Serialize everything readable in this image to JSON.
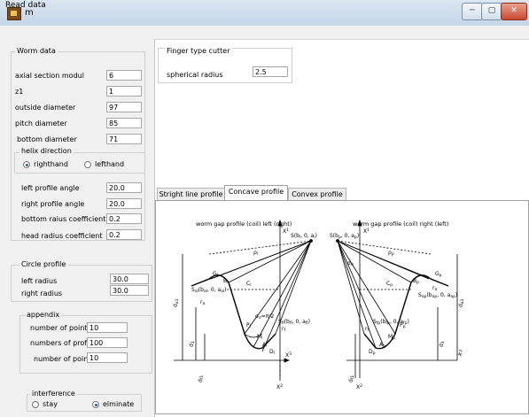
{
  "window": {
    "title": "m",
    "min_glyph": "─",
    "max_glyph": "▢",
    "close_glyph": "✕"
  },
  "menu": {
    "read_data": "Read data"
  },
  "worm": {
    "group_label": "Worm data",
    "fields": [
      {
        "label": "axial  section modul",
        "value": "6"
      },
      {
        "label": "z1",
        "value": "1"
      },
      {
        "label": "outside diameter",
        "value": "97"
      },
      {
        "label": "pitch diameter",
        "value": "85"
      },
      {
        "label": "bottom diameter",
        "value": "71"
      }
    ],
    "helix": {
      "label": "helix direction",
      "right": "righthand",
      "left": "lefthand",
      "selected": "righthand"
    },
    "profile_fields": [
      {
        "label": "left profile angle",
        "value": "20.0"
      },
      {
        "label": "right profile angle",
        "value": "20.0"
      },
      {
        "label": "bottom raius coefficient",
        "value": "0.2"
      },
      {
        "label": "head radius coefficient",
        "value": "0.2"
      }
    ]
  },
  "circle": {
    "group_label": "Circle profile",
    "left_label": "left radius",
    "left_value": "30.0",
    "right_label": "right radius",
    "right_value": "30.0"
  },
  "appendix": {
    "group_label": "appendix",
    "fields": [
      {
        "label": "number of points - botto",
        "value": "10"
      },
      {
        "label": "numbers of profile point",
        "value": "100"
      },
      {
        "label": "number of points - hea",
        "value": "10"
      }
    ]
  },
  "interference": {
    "group_label": "interference",
    "stay": "stay",
    "eliminate": "elminate",
    "selected": "eliminate"
  },
  "finger": {
    "group_label": "Finger type cutter",
    "radius_label": "spherical radius",
    "radius_value": "2.5"
  },
  "tabs": {
    "straight": "Stright line profile",
    "concave": "Concave profile",
    "convex": "Convex profile",
    "active": "concave"
  },
  "diagram": {
    "left_title": "worm gap profile (coil) left (right)",
    "right_title": "worm gap profile (coil) right (left)",
    "left_labels": {
      "x1": "X",
      "x1_sup": "1",
      "s_top": "S(b",
      "s_top_rest": ", 0, a",
      "r": "r",
      "c": "C",
      "g": "G",
      "b": "B",
      "sa": "S",
      "sa_rest": "(b",
      "sa_rest2": ", 0, a",
      "p": "P",
      "m": "M",
      "a": "A",
      "d": "D",
      "sf": "S",
      "sf_rest": "(b",
      "sf_rest2": ", 0, a",
      "da": "d",
      "da_sub": "a1",
      "d1": "d",
      "d1_sub": "1",
      "df": "d",
      "df_sub": "f1",
      "x3": "X",
      "x3_sup": "3",
      "x2": "X",
      "x2_sup": "2",
      "sigma": "σ",
      "rho": "ρ",
      "ra": "r",
      "s_sub": "l",
      "s_sub2": "l",
      "sa_sub": "al",
      "sa_sub2": "al",
      "sa_sub3": "al",
      "sf_sub": "fl",
      "sf_sub2": "fl",
      "sf_sub3": "fl",
      "sigma_sub": "σ",
      "pi": "π/2",
      "ra_sub": "a",
      "rf": "f",
      "g_sub": "l",
      "b_sub": "l",
      "p_sub": "l",
      "m_sub": "l",
      "a_sub": "l",
      "d_sub": "l",
      "c_sub": "l",
      "r_sub": "l"
    },
    "right_labels": {
      "x1": "X",
      "x1_sup": "1",
      "s_top": "S(b",
      "s_top_rest": ", 0, a",
      "r": "r",
      "c": "C",
      "g": "G",
      "b": "B",
      "sa": "S",
      "sa_rest": "(b",
      "sa_rest2": ", 0, a",
      "p": "P",
      "m": "M",
      "a": "A",
      "d": "D",
      "sf": "S",
      "sf_rest": "(b",
      "sf_rest2": ", 0, a",
      "da": "d",
      "da_sub": "a1",
      "d1": "d",
      "d1_sub": "1",
      "df": "d",
      "df_sub": "f1",
      "x3": "X",
      "x3_sup": "3",
      "x2": "X",
      "x2_sup": "2",
      "sigma": "σ",
      "rho": "ρ",
      "ra": "r",
      "s_sub": "p",
      "s_sub2": "p",
      "sa_sub": "ap",
      "sa_sub2": "ap",
      "sa_sub3": "ap",
      "sf_sub": "fp",
      "sf_sub2": "fp",
      "sf_sub3": "fp",
      "sigma_sub": "σ",
      "ra_sub": "a",
      "rf": "f",
      "g_sub": "p",
      "b_sub": "p",
      "p_sub": "p",
      "m_sub": "p",
      "a_sub": "p",
      "d_sub": "p",
      "c_sub": "p",
      "r_sub": "p"
    }
  }
}
